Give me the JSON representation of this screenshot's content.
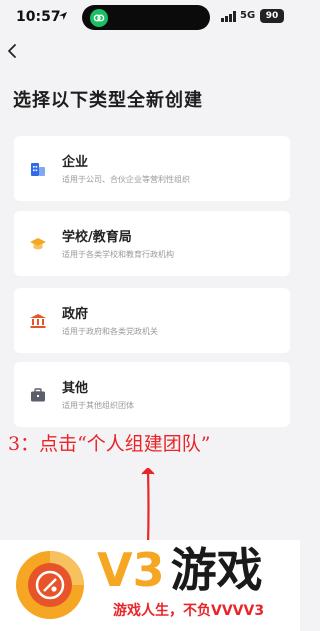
{
  "status_bar": {
    "time": "10:57",
    "network": "5G",
    "battery": "90"
  },
  "header": {
    "title": "选择以下类型全新创建"
  },
  "options": [
    {
      "title": "企业",
      "desc": "适用于公司、合伙企业等营利性组织",
      "icon": "building-icon"
    },
    {
      "title": "学校/教育局",
      "desc": "适用于各类学校和教育行政机构",
      "icon": "graduation-cap-icon"
    },
    {
      "title": "政府",
      "desc": "适用于政府和各类党政机关",
      "icon": "government-icon"
    },
    {
      "title": "其他",
      "desc": "适用于其他组织团体",
      "icon": "briefcase-icon"
    }
  ],
  "annotation": {
    "text": "3：点击“个人组建团队”"
  },
  "watermark": {
    "brand_v3": "V3",
    "brand_game": "游戏",
    "slogan": "游戏人生，不负VVVV3"
  },
  "colors": {
    "background": "#f3f3f5",
    "card": "#ffffff",
    "enterprise_icon": "#2f6be8",
    "school_icon": "#f5a623",
    "government_icon": "#e8542a",
    "other_icon": "#5a5f6b",
    "annotation": "#e8262a",
    "wechat_green": "#18c063",
    "watermark_orange": "#f5a623"
  }
}
